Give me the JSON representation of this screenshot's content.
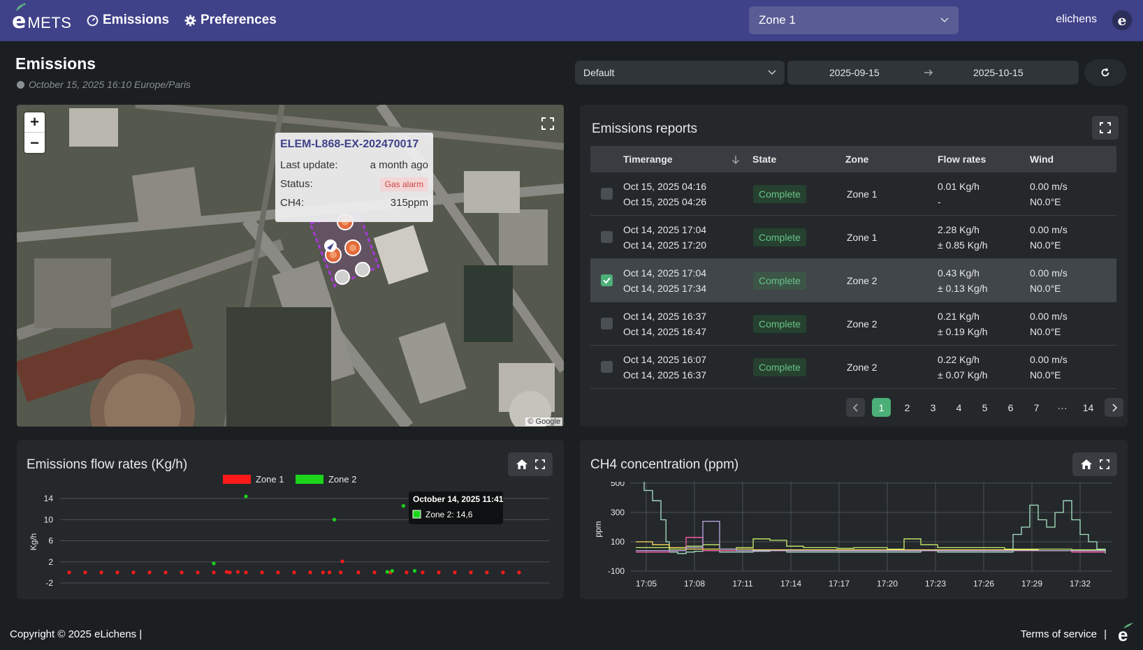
{
  "header": {
    "logo_e": "e",
    "logo_text": "METS",
    "nav": [
      {
        "label": "Emissions",
        "icon": "gauge-icon"
      },
      {
        "label": "Preferences",
        "icon": "gear-icon"
      }
    ],
    "zone_selected": "Zone 1",
    "user": "elichens",
    "avatar_letter": "e"
  },
  "page": {
    "title": "Emissions",
    "subtitle": "October 15, 2025 16:10 Europe/Paris",
    "preset": "Default",
    "date_from": "2025-09-15",
    "date_to": "2025-10-15"
  },
  "map": {
    "popup": {
      "title": "ELEM-L868-EX-202470017",
      "last_update_label": "Last update:",
      "last_update_value": "a month ago",
      "status_label": "Status:",
      "status_value": "Gas alarm",
      "ch4_label": "CH4:",
      "ch4_value": "315ppm"
    },
    "attribution": "© Google",
    "zoom_in": "+",
    "zoom_out": "−"
  },
  "reports": {
    "title": "Emissions reports",
    "columns": [
      "Timerange",
      "State",
      "Zone",
      "Flow rates",
      "Wind"
    ],
    "rows": [
      {
        "start": "Oct 15, 2025 04:16",
        "end": "Oct 15, 2025 04:26",
        "state": "Complete",
        "zone": "Zone 1",
        "flow": "0.01 Kg/h",
        "flow_err": "-",
        "wind": "0.00 m/s",
        "dir": "N0.0°E",
        "checked": false
      },
      {
        "start": "Oct 14, 2025 17:04",
        "end": "Oct 14, 2025 17:20",
        "state": "Complete",
        "zone": "Zone 1",
        "flow": "2.28 Kg/h",
        "flow_err": "± 0.85 Kg/h",
        "wind": "0.00 m/s",
        "dir": "N0.0°E",
        "checked": false
      },
      {
        "start": "Oct 14, 2025 17:04",
        "end": "Oct 14, 2025 17:34",
        "state": "Complete",
        "zone": "Zone 2",
        "flow": "0.43 Kg/h",
        "flow_err": "± 0.13 Kg/h",
        "wind": "0.00 m/s",
        "dir": "N0.0°E",
        "checked": true
      },
      {
        "start": "Oct 14, 2025 16:37",
        "end": "Oct 14, 2025 16:47",
        "state": "Complete",
        "zone": "Zone 2",
        "flow": "0.21 Kg/h",
        "flow_err": "± 0.19 Kg/h",
        "wind": "0.00 m/s",
        "dir": "N0.0°E",
        "checked": false
      },
      {
        "start": "Oct 14, 2025 16:07",
        "end": "Oct 14, 2025 16:37",
        "state": "Complete",
        "zone": "Zone 2",
        "flow": "0.22 Kg/h",
        "flow_err": "± 0.07 Kg/h",
        "wind": "0.00 m/s",
        "dir": "N0.0°E",
        "checked": false
      }
    ],
    "pages": [
      "1",
      "2",
      "3",
      "4",
      "5",
      "6",
      "7",
      "···",
      "14"
    ]
  },
  "footer": {
    "copyright": "Copyright © 2025 eLichens |",
    "terms": "Terms of service",
    "sep": "|"
  },
  "colors": {
    "accent": "#3f4189",
    "zone1": "#ff1a1a",
    "zone2": "#1bd41b",
    "complete": "#68c288"
  },
  "chart_data": [
    {
      "type": "scatter",
      "title": "Emissions flow rates (Kg/h)",
      "ylabel": "Kg/h",
      "ylim": [
        -2,
        14
      ],
      "yticks": [
        -2,
        2,
        6,
        10,
        14
      ],
      "series": [
        {
          "name": "Zone 1",
          "color": "#ff1a1a",
          "x": [
            0,
            1,
            2,
            3,
            4,
            5,
            6,
            7,
            8,
            9,
            9.8,
            10,
            10.5,
            11,
            12,
            13,
            14,
            15,
            15.8,
            16.2,
            16.9,
            17,
            18,
            19,
            20,
            21,
            22,
            23,
            24,
            25,
            26,
            27,
            28
          ],
          "values": [
            0,
            0,
            0,
            0,
            0,
            0,
            0,
            0,
            0,
            0,
            0.1,
            0,
            0.1,
            0,
            0,
            0,
            0,
            0,
            0,
            0,
            0,
            2.1,
            0,
            0,
            0,
            0,
            0,
            0,
            0,
            0,
            0,
            0,
            0
          ]
        },
        {
          "name": "Zone 2",
          "color": "#1bd41b",
          "x": [
            9,
            11,
            16.5,
            20.1,
            19.8,
            21.5,
            20.8
          ],
          "values": [
            1.7,
            14.4,
            10,
            0.3,
            0.1,
            0.3,
            12.6
          ]
        }
      ],
      "tooltip": {
        "title": "October 14, 2025 11:41",
        "label": "Zone 2: 14,6"
      }
    },
    {
      "type": "line",
      "title": "CH4 concentration (ppm)",
      "ylabel": "ppm",
      "ylim": [
        -100,
        500
      ],
      "yticks": [
        -100,
        100,
        300,
        500
      ],
      "xticks": [
        "17:05",
        "17:08",
        "17:11",
        "17:14",
        "17:17",
        "17:20",
        "17:23",
        "17:26",
        "17:29",
        "17:32"
      ],
      "series": [
        {
          "color": "#a9e3c3",
          "x": [
            0,
            0.5,
            1,
            1.5,
            1.8,
            2,
            2.5,
            3,
            3.5,
            4,
            5,
            6,
            7,
            8,
            9,
            10,
            11,
            12,
            13,
            14,
            15,
            16,
            17,
            18,
            19,
            20,
            21,
            22,
            22.5,
            23,
            23.5,
            24,
            24.5,
            25,
            25.5,
            26,
            26.5,
            27,
            27.5,
            28
          ],
          "values": [
            530,
            450,
            380,
            250,
            100,
            30,
            20,
            30,
            35,
            40,
            30,
            30,
            35,
            40,
            30,
            30,
            30,
            30,
            30,
            30,
            30,
            30,
            40,
            30,
            30,
            30,
            30,
            30,
            150,
            200,
            350,
            250,
            200,
            300,
            380,
            250,
            150,
            100,
            50,
            20
          ]
        },
        {
          "color": "#c5f06a",
          "x": [
            0,
            1,
            2,
            3,
            4,
            5,
            6,
            7,
            8,
            9,
            10,
            11,
            12,
            13,
            14,
            15,
            16,
            17,
            18,
            19,
            20,
            21,
            22,
            23,
            24,
            25,
            26,
            27,
            28
          ],
          "values": [
            60,
            60,
            50,
            70,
            80,
            50,
            60,
            120,
            110,
            70,
            60,
            60,
            55,
            60,
            60,
            50,
            120,
            80,
            60,
            60,
            60,
            60,
            50,
            50,
            50,
            50,
            45,
            45,
            45
          ]
        },
        {
          "color": "#ff5fa8",
          "x": [
            0,
            1,
            2,
            3,
            4,
            5,
            6,
            7,
            8,
            9,
            10,
            11,
            12,
            13,
            14,
            15,
            16,
            17,
            18,
            19,
            20,
            21,
            22,
            23,
            24,
            25,
            26,
            27,
            28
          ],
          "values": [
            30,
            30,
            40,
            130,
            40,
            40,
            40,
            40,
            40,
            40,
            40,
            40,
            40,
            40,
            40,
            40,
            40,
            40,
            40,
            40,
            40,
            40,
            40,
            40,
            40,
            40,
            30,
            30,
            30
          ]
        },
        {
          "color": "#ffe259",
          "x": [
            0,
            1,
            2,
            3,
            4,
            5,
            6,
            7,
            8,
            9,
            10,
            11,
            12,
            13,
            14,
            15,
            16,
            17,
            18,
            19,
            20,
            21,
            22,
            23,
            24,
            25,
            26,
            27,
            28
          ],
          "values": [
            100,
            80,
            60,
            50,
            50,
            50,
            50,
            45,
            45,
            45,
            45,
            45,
            45,
            45,
            45,
            45,
            45,
            45,
            45,
            45,
            45,
            45,
            45,
            45,
            40,
            40,
            40,
            40,
            40
          ]
        },
        {
          "color": "#bba8e8",
          "x": [
            0,
            1,
            2,
            3,
            4,
            5,
            6,
            7,
            8,
            9,
            10,
            11,
            12,
            13,
            14,
            15,
            16,
            17,
            18,
            19,
            20,
            21,
            22,
            23,
            24,
            25,
            26,
            27,
            28
          ],
          "values": [
            40,
            40,
            40,
            60,
            240,
            50,
            40,
            40,
            40,
            40,
            40,
            40,
            40,
            40,
            40,
            40,
            40,
            40,
            40,
            40,
            40,
            40,
            40,
            40,
            40,
            40,
            40,
            40,
            40
          ]
        }
      ]
    }
  ]
}
